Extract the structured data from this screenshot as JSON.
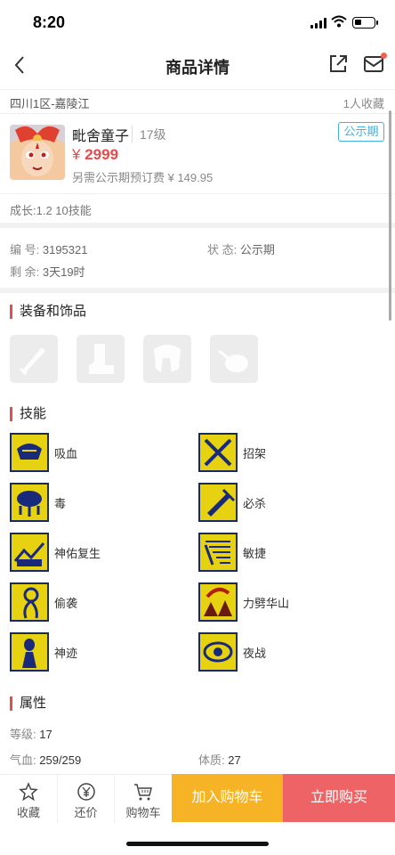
{
  "status": {
    "time": "8:20"
  },
  "nav": {
    "title": "商品详情",
    "back_icon": "back-icon",
    "share_icon": "share-icon",
    "mail_icon": "mail-icon"
  },
  "info": {
    "server": "四川1区-嘉陵江",
    "favorites": "1人收藏"
  },
  "product": {
    "name": "毗舍童子",
    "level": "17级",
    "badge": "公示期",
    "price_symbol": "¥",
    "price": "2999",
    "prefee": "另需公示期预订费 ¥ 149.95",
    "growth": "成长:1.2 10技能"
  },
  "meta": {
    "id_label": "编 号:",
    "id_value": "3195321",
    "state_label": "状 态:",
    "state_value": "公示期",
    "remain_label": "剩 余:",
    "remain_value": "3天19时"
  },
  "sections": {
    "equip": "装备和饰品",
    "skills": "技能",
    "attrs": "属性"
  },
  "equipment": [
    "weapon-icon",
    "boots-icon",
    "armor-icon",
    "accessory-icon"
  ],
  "skills": [
    {
      "name": "吸血",
      "icon": "vampire-skill-icon"
    },
    {
      "name": "招架",
      "icon": "parry-skill-icon"
    },
    {
      "name": "毒",
      "icon": "poison-skill-icon"
    },
    {
      "name": "必杀",
      "icon": "critical-skill-icon"
    },
    {
      "name": "神佑复生",
      "icon": "revive-skill-icon"
    },
    {
      "name": "敏捷",
      "icon": "agility-skill-icon"
    },
    {
      "name": "偷袭",
      "icon": "sneak-skill-icon"
    },
    {
      "name": "力劈华山",
      "icon": "cleave-skill-icon"
    },
    {
      "name": "神迹",
      "icon": "miracle-skill-icon"
    },
    {
      "name": "夜战",
      "icon": "night-skill-icon"
    }
  ],
  "attributes": {
    "level_label": "等级:",
    "level_value": "17",
    "hp_label": "气血:",
    "hp_value": "259/259",
    "con_label": "体质:",
    "con_value": "27"
  },
  "bottom": {
    "favorite": "收藏",
    "bargain": "还价",
    "cart": "购物车",
    "add_cart": "加入购物车",
    "buy_now": "立即购买"
  },
  "colors": {
    "accent_red": "#ee6466",
    "accent_yellow": "#f5b325",
    "badge_blue": "#42b0e0",
    "price_red": "#e64a4a"
  }
}
